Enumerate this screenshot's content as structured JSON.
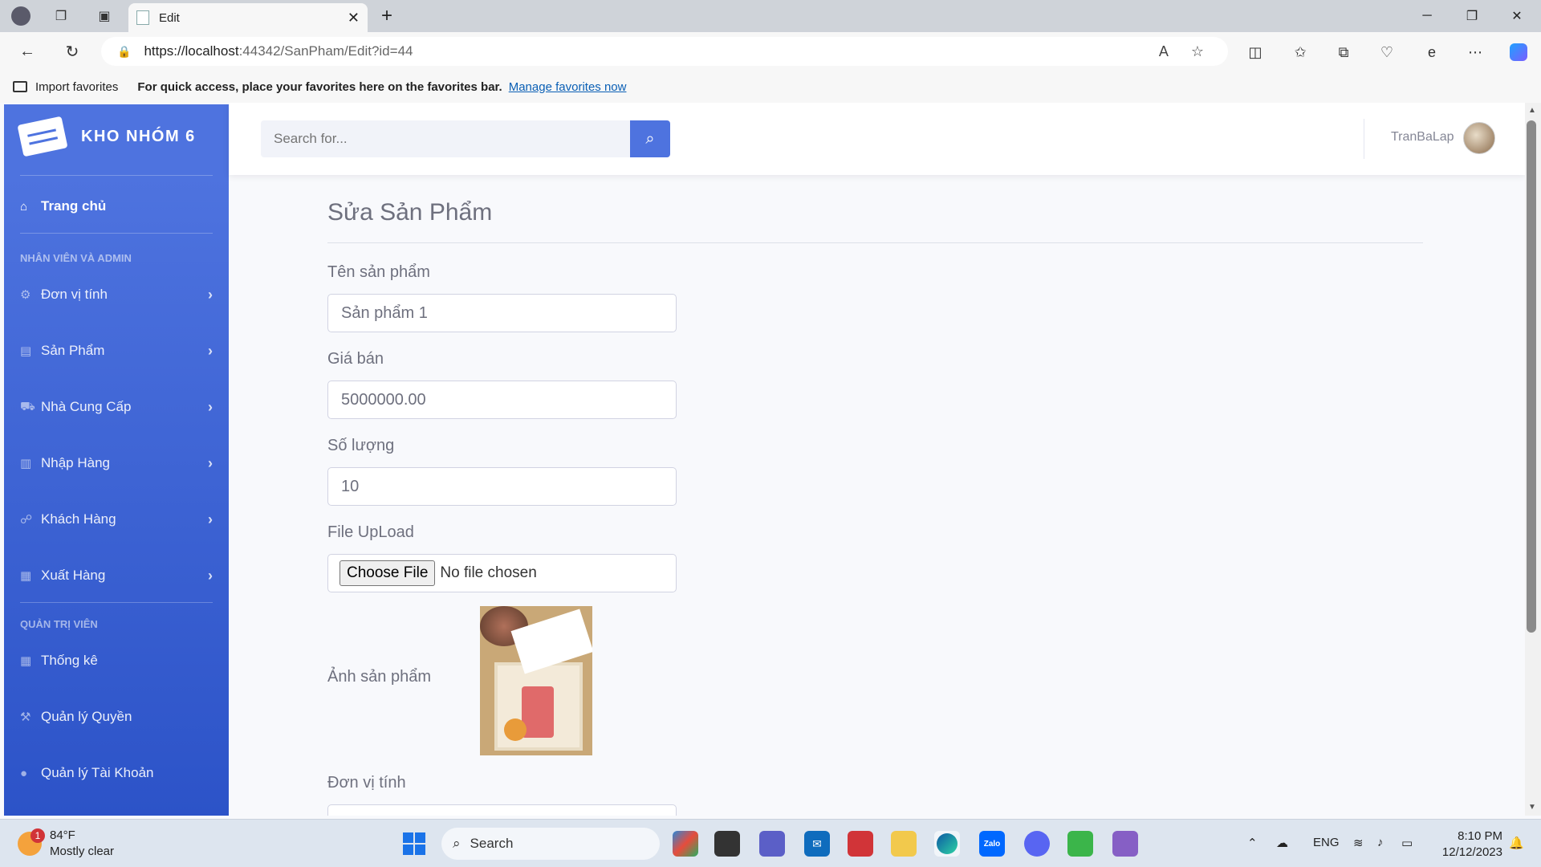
{
  "browser": {
    "tab_title": "Edit",
    "url_host": "https://localhost",
    "url_path": ":44342/SanPham/Edit?id=44",
    "favorites_import": "Import favorites",
    "favorites_hint": "For quick access, place your favorites here on the favorites bar.",
    "favorites_manage": "Manage favorites now"
  },
  "sidebar": {
    "brand": "KHO NHÓM 6",
    "home": "Trang chủ",
    "section1": "NHÂN VIÊN VÀ ADMIN",
    "items": [
      {
        "label": "Đơn vị tính",
        "icon": "gear-icon"
      },
      {
        "label": "Sản Phẩm",
        "icon": "cart-icon"
      },
      {
        "label": "Nhà Cung Cấp",
        "icon": "truck-icon"
      },
      {
        "label": "Nhập Hàng",
        "icon": "import-icon"
      },
      {
        "label": "Khách Hàng",
        "icon": "handshake-icon"
      },
      {
        "label": "Xuất Hàng",
        "icon": "export-icon"
      }
    ],
    "section2": "QUẢN TRỊ VIÊN",
    "admin_items": [
      {
        "label": "Thống kê",
        "icon": "calculator-icon"
      },
      {
        "label": "Quản lý Quyền",
        "icon": "hammer-icon"
      },
      {
        "label": "Quản lý Tài Khoản",
        "icon": "user-icon"
      }
    ]
  },
  "topbar": {
    "search_placeholder": "Search for...",
    "username": "TranBaLap"
  },
  "form": {
    "heading": "Sửa Sản Phẩm",
    "name_label": "Tên sản phẩm",
    "name_value": "Sản phẩm 1",
    "price_label": "Giá bán",
    "price_value": "5000000.00",
    "qty_label": "Số lượng",
    "qty_value": "10",
    "file_label": "File UpLoad",
    "file_button": "Choose File",
    "file_status": "No file chosen",
    "image_label": "Ảnh sản phẩm",
    "unit_label": "Đơn vị tính"
  },
  "taskbar": {
    "weather_temp": "84°F",
    "weather_desc": "Mostly clear",
    "weather_badge": "1",
    "search_label": "Search",
    "lang": "ENG",
    "time": "8:10 PM",
    "date": "12/12/2023"
  },
  "colors": {
    "sidebar": "#4e73df",
    "accent": "#4e73df"
  }
}
